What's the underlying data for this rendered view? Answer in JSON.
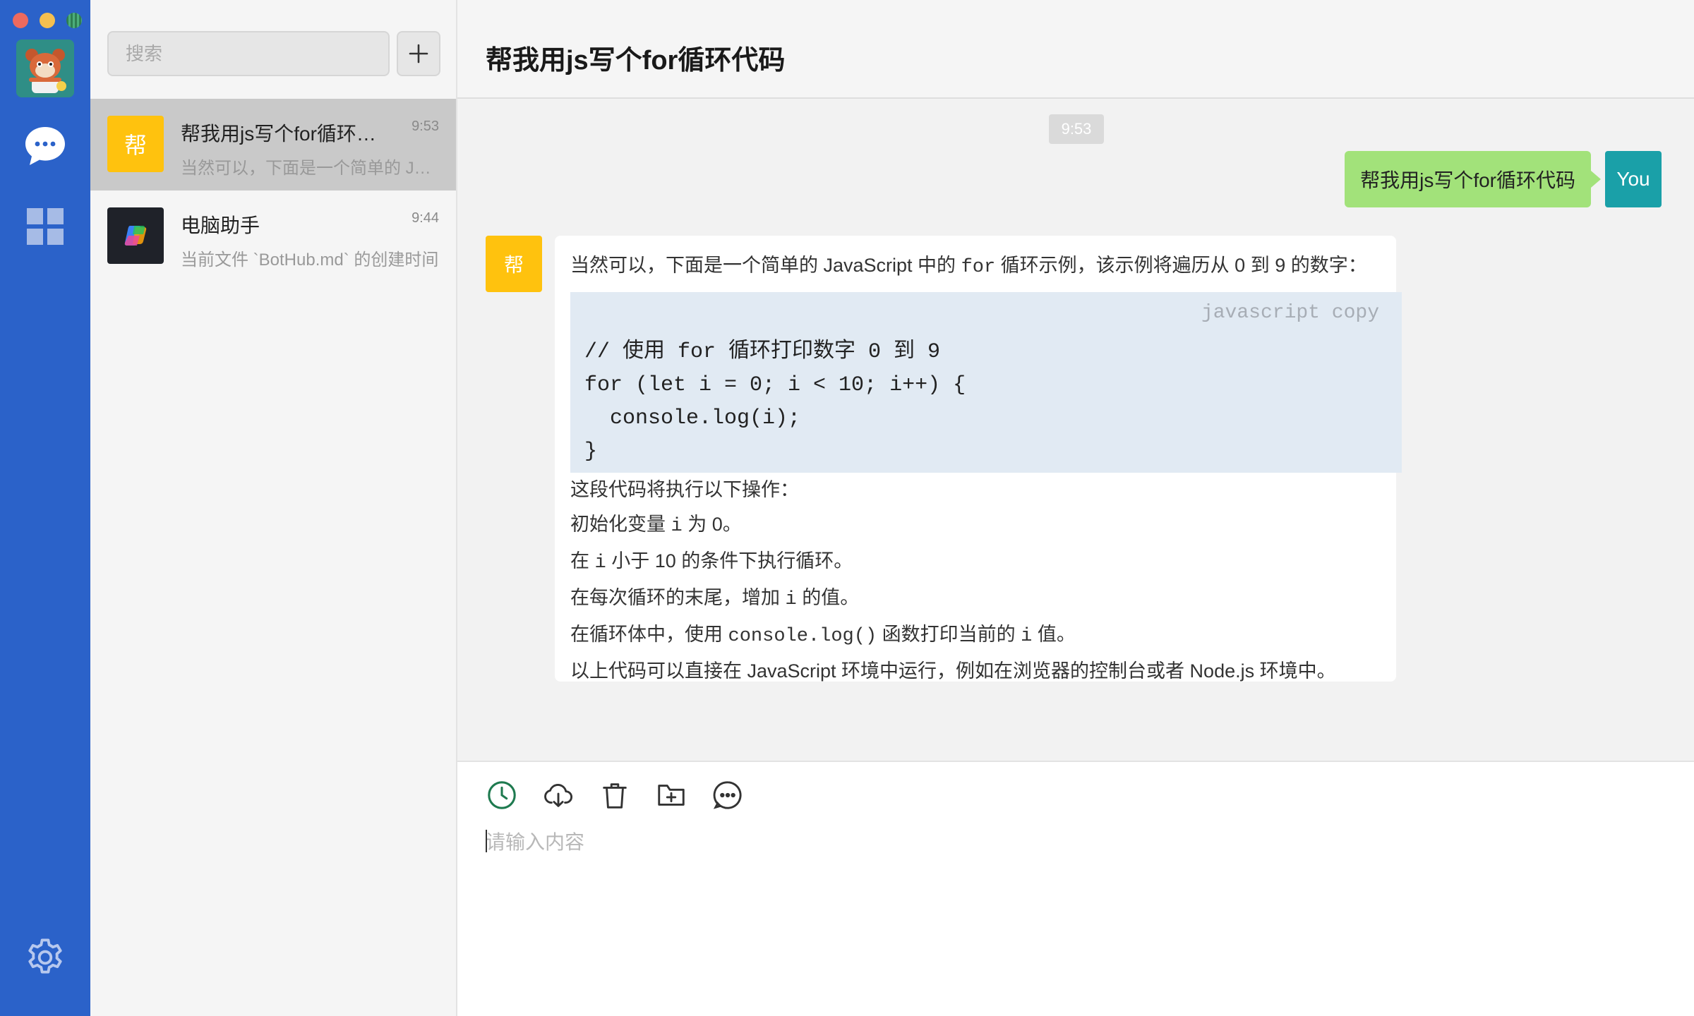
{
  "sidebar": {
    "user_avatar": "user-avatar-illustration",
    "nav": [
      {
        "name": "chat-bubble-icon",
        "active": true
      },
      {
        "name": "apps-grid-icon",
        "active": false
      }
    ],
    "settings": "gear-icon"
  },
  "search": {
    "placeholder": "搜索",
    "value": ""
  },
  "conversations": [
    {
      "avatar_text": "帮",
      "avatar_color": "#ffc20e",
      "title": "帮我用js写个for循环代码",
      "time": "9:53",
      "preview": "当然可以，下面是一个简单的 JavaScript 中的 for 循环示例",
      "active": true
    },
    {
      "avatar_text": "",
      "avatar_color": "#1f2229",
      "title": "电脑助手",
      "time": "9:44",
      "preview": "当前文件 `BotHub.md` 的创建时间",
      "active": false
    }
  ],
  "chat": {
    "title": "帮我用js写个for循环代码",
    "time_divider": "9:53",
    "user_message": "帮我用js写个for循环代码",
    "user_badge": "You",
    "bot_avatar_text": "帮",
    "bot_reply": {
      "intro_a": "当然可以，下面是一个简单的 JavaScript 中的 ",
      "intro_code": "for",
      "intro_b": " 循环示例，该示例将遍历从 0 到 9 的数字：",
      "code_lang": "javascript copy",
      "code_lines": [
        "// 使用 for 循环打印数字 0 到 9",
        "for (let i = 0; i < 10; i++) {",
        "  console.log(i);",
        "}"
      ],
      "steps_intro": "这段代码将执行以下操作：",
      "step1_a": "初始化变量 ",
      "step1_code": "i",
      "step1_b": " 为 0。",
      "step2_a": "在 ",
      "step2_code": "i",
      "step2_b": " 小于 10 的条件下执行循环。",
      "step3_a": "在每次循环的末尾，增加 ",
      "step3_code": "i",
      "step3_b": " 的值。",
      "step4_a": "在循环体中，使用 ",
      "step4_code": "console.log()",
      "step4_b": " 函数打印当前的 ",
      "step4_code2": "i",
      "step4_c": " 值。",
      "outro": "以上代码可以直接在 JavaScript 环境中运行，例如在浏览器的控制台或者 Node.js 环境中。"
    }
  },
  "composer": {
    "placeholder": "请输入内容",
    "value": "",
    "tools": [
      "history-clock-icon",
      "cloud-download-icon",
      "trash-icon",
      "folder-add-icon",
      "more-chat-icon"
    ],
    "accent": "#1e7a4f"
  },
  "colors": {
    "rail": "#2b62c9",
    "user_bubble": "#a2e27a",
    "user_badge": "#1aa0a8",
    "bot_avatar": "#ffc20e",
    "code_bg": "#e1eaf3"
  }
}
